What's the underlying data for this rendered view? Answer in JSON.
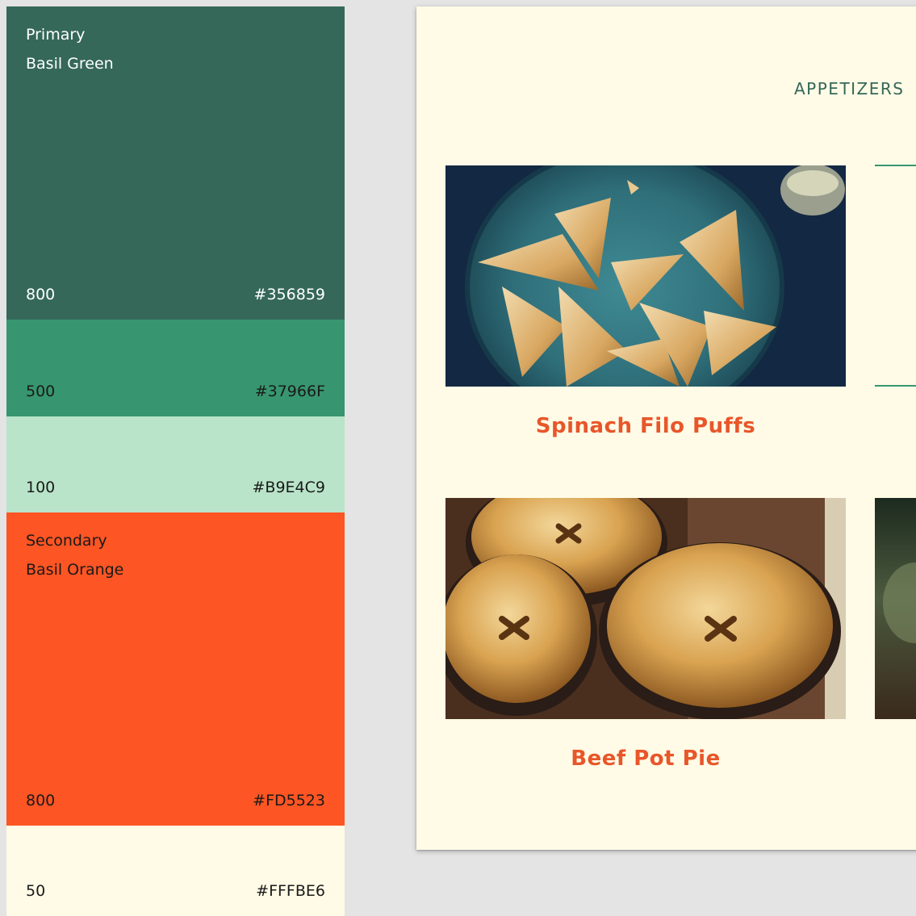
{
  "palette": {
    "primary": {
      "role": "Primary",
      "name": "Basil Green",
      "shades": [
        {
          "shade": "800",
          "hex": "#356859"
        },
        {
          "shade": "500",
          "hex": "#37966F"
        },
        {
          "shade": "100",
          "hex": "#B9E4C9"
        }
      ]
    },
    "secondary": {
      "role": "Secondary",
      "name": "Basil Orange",
      "shades": [
        {
          "shade": "800",
          "hex": "#FD5523"
        },
        {
          "shade": "50",
          "hex": "#FFFBE6"
        }
      ]
    }
  },
  "mockup": {
    "section_title": "APPETIZERS",
    "dishes": [
      {
        "name": "Spinach Filo Puffs",
        "image": "filo-pastry-plate-photo"
      },
      {
        "name": "Beef Pot Pie",
        "image": "pot-pie-photo"
      }
    ],
    "side_image": "side-dish-photo"
  },
  "colors": {
    "green800": "#356859",
    "green500": "#37966F",
    "green100": "#B9E4C9",
    "orange800": "#FD5523",
    "cream50": "#FFFBE6",
    "title_green": "#356859",
    "caption_orange": "#E8562A",
    "background": "#e4e4e4"
  }
}
